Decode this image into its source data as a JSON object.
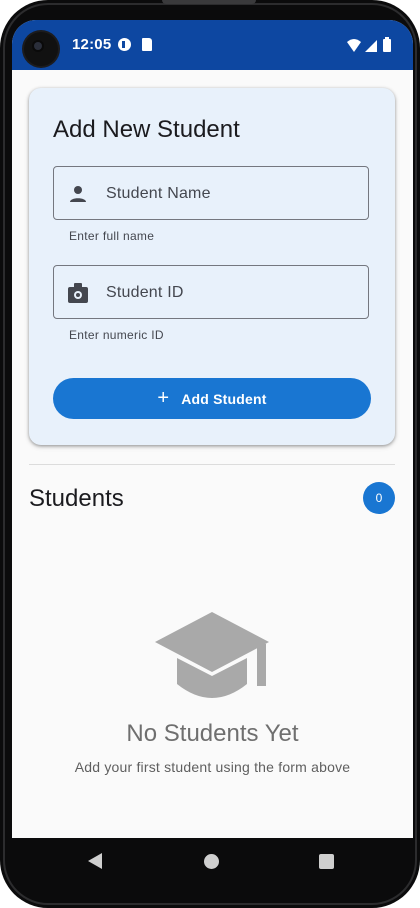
{
  "status_bar": {
    "time": "12:05",
    "background_color": "#0d47a1",
    "icons": [
      "camera-icon",
      "media-icon",
      "sd-card-icon",
      "wifi-icon",
      "signal-icon",
      "battery-icon"
    ]
  },
  "form_card": {
    "title": "Add New Student",
    "background_color": "#e8f1fb",
    "name_field": {
      "label": "Student Name",
      "helper": "Enter full name",
      "icon": "person-icon",
      "value": ""
    },
    "id_field": {
      "label": "Student ID",
      "helper": "Enter numeric ID",
      "icon": "badge-icon",
      "value": ""
    },
    "add_button": {
      "icon": "+",
      "label": "Add Student",
      "color": "#1976d2"
    }
  },
  "students_section": {
    "title": "Students",
    "count": "0"
  },
  "empty_state": {
    "icon": "graduation-cap-icon",
    "title": "No Students Yet",
    "subtitle": "Add your first student using the form above"
  },
  "nav_bar": {
    "icons": [
      "back-icon",
      "home-icon",
      "recents-icon"
    ]
  }
}
